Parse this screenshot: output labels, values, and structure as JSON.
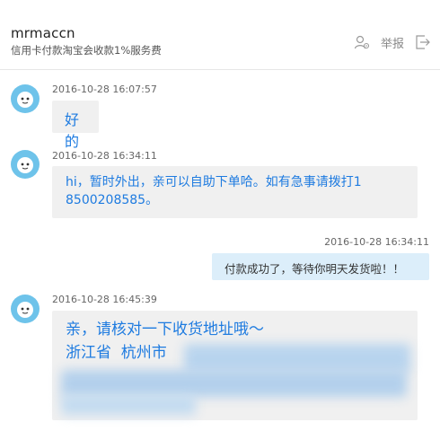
{
  "header": {
    "username": "mrmaccn",
    "subtitle": "信用卡付款淘宝会收款1%服务费",
    "report_label": "举报",
    "icons": [
      "user-settings-icon",
      "exit-icon"
    ]
  },
  "colors": {
    "avatar": "#6ec3ea",
    "incoming_text": "#1e7be0",
    "incoming_bubble": "#f0f0f0",
    "outgoing_bubble": "#dceefa"
  },
  "messages": [
    {
      "side": "left",
      "time": "2016-10-28 16:07:57",
      "lines": [
        "好的"
      ]
    },
    {
      "side": "left",
      "time": "2016-10-28 16:34:11",
      "lines": [
        "hi，暂时外出，亲可以自助下单哈。如有急事请拨打1",
        "8500208585。"
      ]
    },
    {
      "side": "right",
      "time": "2016-10-28 16:34:11",
      "lines": [
        "付款成功了，等待你明天发货啦！！"
      ]
    },
    {
      "side": "left",
      "time": "2016-10-28 16:45:39",
      "lines": [
        "亲，请核对一下收货地址哦～",
        "浙江省  杭州市"
      ]
    }
  ]
}
